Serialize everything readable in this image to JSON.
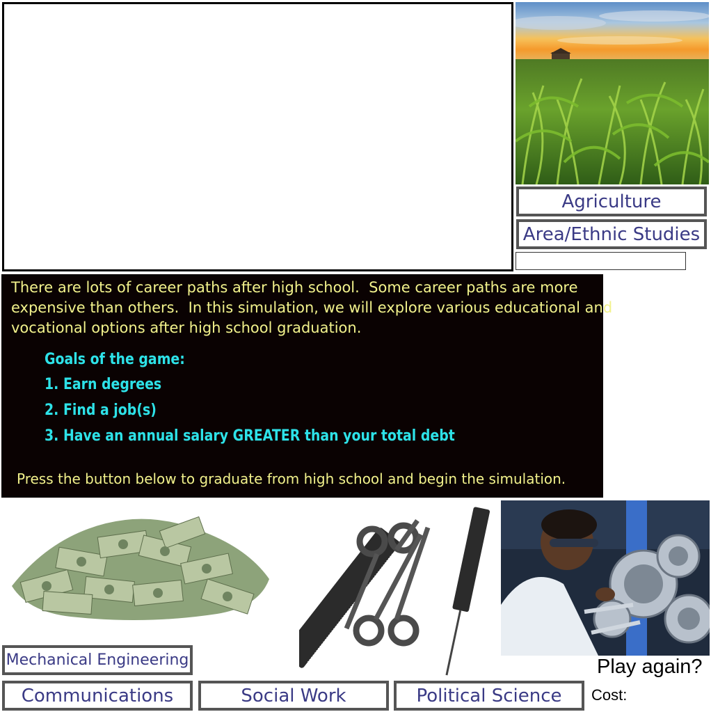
{
  "buttons": {
    "agriculture": "Agriculture",
    "area_ethnic": "Area/Ethnic Studies",
    "mech_eng": "Mechanical Engineering",
    "communications": "Communications",
    "social_work": "Social Work",
    "political_science": "Political Science"
  },
  "intro": {
    "line1": "There are lots of career paths after high school.  Some career paths are more",
    "line2": "expensive than others.  In this simulation, we will explore various educational and",
    "line3": "vocational options after high school graduation."
  },
  "goals": {
    "title": "Goals of the game:",
    "items": [
      "1. Earn degrees",
      "2. Find a job(s)",
      "3. Have an annual salary GREATER than your total debt"
    ]
  },
  "press_text": "Press the button below to graduate from high school and begin the simulation.",
  "play_again": "Play again?",
  "cost_label": "Cost:",
  "images": {
    "corn": "cornfield-sunset-image",
    "money": "money-pile-image",
    "tools": "scissors-combs-image",
    "scientist": "scientist-lab-image"
  }
}
